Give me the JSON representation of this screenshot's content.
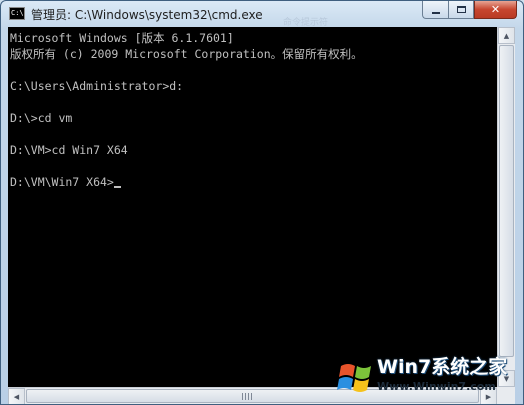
{
  "window": {
    "title": "管理员: C:\\Windows\\system32\\cmd.exe",
    "icon_label": "C:\\",
    "ghost_title": "命令提示符"
  },
  "controls": {
    "minimize_icon": "minimize-icon",
    "maximize_icon": "maximize-icon",
    "close_icon": "close-icon",
    "close_glyph": "✕"
  },
  "console": {
    "lines": [
      "Microsoft Windows [版本 6.1.7601]",
      "版权所有 (c) 2009 Microsoft Corporation。保留所有权利。",
      "",
      "C:\\Users\\Administrator>d:",
      "",
      "D:\\>cd vm",
      "",
      "D:\\VM>cd Win7 X64",
      "",
      "D:\\VM\\Win7 X64>"
    ],
    "foreground": "#c0c0c0",
    "background": "#000000"
  },
  "scrollbars": {
    "up_arrow": "▲",
    "down_arrow": "▼",
    "left_arrow": "◀",
    "right_arrow": "▶"
  },
  "watermark": {
    "brand": "Win7系统之家",
    "url": "Www.Winwin7.com"
  }
}
